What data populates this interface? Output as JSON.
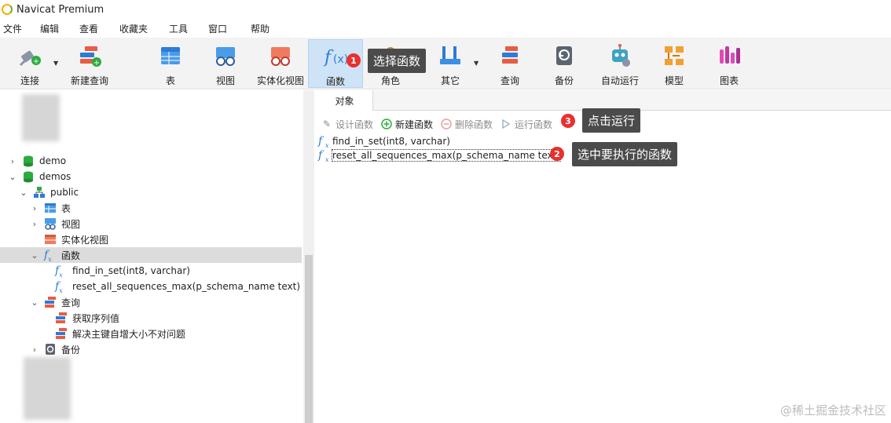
{
  "window": {
    "title": "Navicat Premium"
  },
  "menu": [
    "文件",
    "编辑",
    "查看",
    "收藏夹",
    "工具",
    "窗口",
    "帮助"
  ],
  "toolbar": {
    "items": [
      {
        "label": "连接",
        "icon": "plug-icon"
      },
      {
        "label": "新建查询",
        "icon": "new-query-icon"
      },
      {
        "label": "表",
        "icon": "table-icon"
      },
      {
        "label": "视图",
        "icon": "view-icon"
      },
      {
        "label": "实体化视图",
        "icon": "materialized-view-icon"
      },
      {
        "label": "函数",
        "icon": "function-icon",
        "active": true
      },
      {
        "label": "角色",
        "icon": "role-icon"
      },
      {
        "label": "其它",
        "icon": "tools-icon"
      },
      {
        "label": "查询",
        "icon": "query-icon"
      },
      {
        "label": "备份",
        "icon": "backup-icon"
      },
      {
        "label": "自动运行",
        "icon": "robot-icon"
      },
      {
        "label": "模型",
        "icon": "model-icon"
      },
      {
        "label": "图表",
        "icon": "chart-icon"
      }
    ]
  },
  "tree": {
    "nodes": [
      {
        "label": "demo",
        "level": 0,
        "expanded": false,
        "icon": "database-icon"
      },
      {
        "label": "demos",
        "level": 0,
        "expanded": true,
        "icon": "database-icon"
      },
      {
        "label": "public",
        "level": 1,
        "expanded": true,
        "icon": "schema-icon"
      },
      {
        "label": "表",
        "level": 2,
        "expanded": false,
        "icon": "table-icon"
      },
      {
        "label": "视图",
        "level": 2,
        "expanded": false,
        "icon": "view-icon"
      },
      {
        "label": "实体化视图",
        "level": 2,
        "expanded": null,
        "icon": "materialized-view-icon"
      },
      {
        "label": "函数",
        "level": 2,
        "expanded": true,
        "icon": "function-icon",
        "selected": true
      },
      {
        "label": "find_in_set(int8, varchar)",
        "level": 3,
        "expanded": null,
        "icon": "function-icon"
      },
      {
        "label": "reset_all_sequences_max(p_schema_name text)",
        "level": 3,
        "expanded": null,
        "icon": "function-icon"
      },
      {
        "label": "查询",
        "level": 2,
        "expanded": true,
        "icon": "query-icon"
      },
      {
        "label": "获取序列值",
        "level": 3,
        "expanded": null,
        "icon": "query-icon"
      },
      {
        "label": "解决主键自增大小不对问题",
        "level": 3,
        "expanded": null,
        "icon": "query-icon"
      },
      {
        "label": "备份",
        "level": 2,
        "expanded": false,
        "icon": "backup-icon"
      }
    ]
  },
  "panel": {
    "tab": "对象",
    "actions": [
      {
        "label": "设计函数",
        "icon": "pencil-icon",
        "enabled": false
      },
      {
        "label": "新建函数",
        "icon": "plus-circle-icon",
        "enabled": true
      },
      {
        "label": "删除函数",
        "icon": "minus-circle-icon",
        "enabled": false
      },
      {
        "label": "运行函数",
        "icon": "play-icon",
        "enabled": false
      }
    ],
    "functions": [
      {
        "name": "find_in_set(int8, varchar)"
      },
      {
        "name": "reset_all_sequences_max(p_schema_name text)",
        "focused": true
      }
    ]
  },
  "annotations": [
    {
      "number": "1",
      "text": "选择函数"
    },
    {
      "number": "2",
      "text": "选中要执行的函数"
    },
    {
      "number": "3",
      "text": "点击运行"
    }
  ],
  "watermark": "@稀土掘金技术社区",
  "colors": {
    "accent": "#2d7bd6",
    "badge": "#e8312f",
    "callout": "#4b4b4b",
    "active_tool": "#cfe3f6"
  }
}
